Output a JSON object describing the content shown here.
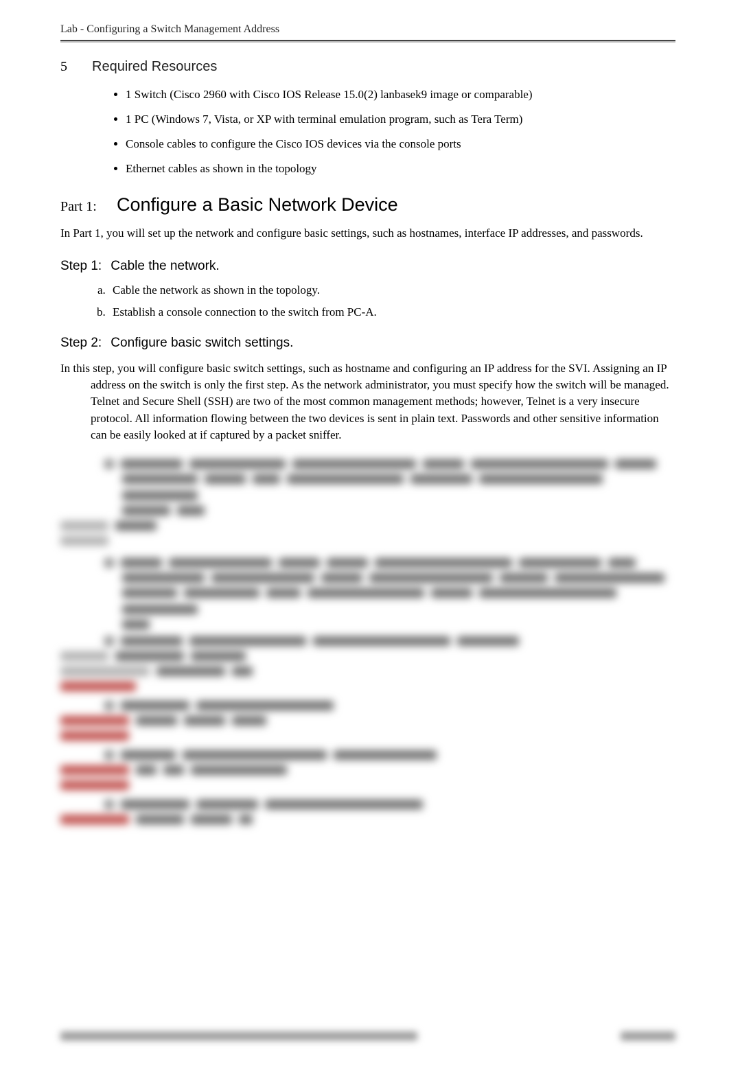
{
  "header": {
    "title": "Lab - Configuring a Switch Management Address"
  },
  "section5": {
    "number": "5",
    "title": "Required Resources",
    "bullets": [
      "1 Switch (Cisco 2960 with Cisco IOS Release 15.0(2) lanbasek9 image or comparable)",
      "1 PC (Windows 7, Vista, or XP with terminal emulation program, such as Tera Term)",
      "Console cables to configure the Cisco IOS devices via the console ports",
      "Ethernet cables as shown in the topology"
    ]
  },
  "part1": {
    "label": "Part 1:",
    "title": "Configure a Basic Network Device",
    "intro": "In Part 1, you will set up the network and configure basic settings, such as hostnames, interface IP addresses, and passwords."
  },
  "step1": {
    "label": "Step 1:",
    "title": "Cable the network.",
    "items": [
      "Cable the network as shown in the topology.",
      "Establish a console connection to the switch from PC-A."
    ]
  },
  "step2": {
    "label": "Step 2:",
    "title": "Configure basic switch settings.",
    "body": "In this step, you will configure basic switch settings, such as hostname and configuring an IP address for the SVI. Assigning an IP address on the switch is only the first step. As the network administrator, you must specify how the switch will be managed. Telnet and Secure Shell (SSH) are two of the most common management methods; however, Telnet is a very insecure protocol. All information flowing between the two devices is sent in plain text. Passwords and other sensitive information can be easily looked at if captured by a packet sniffer."
  }
}
